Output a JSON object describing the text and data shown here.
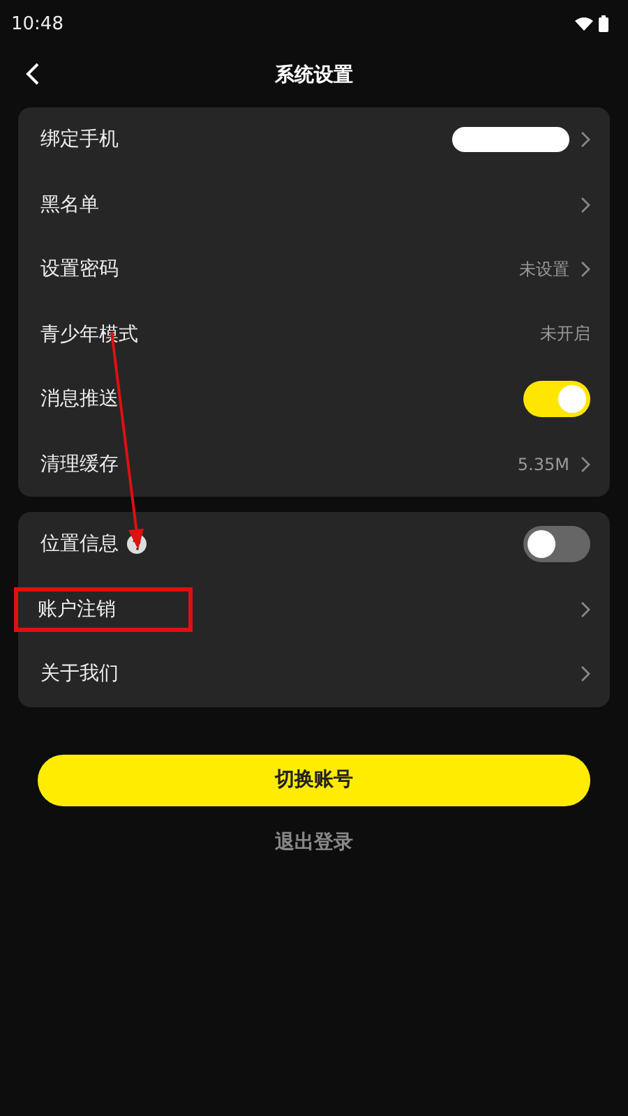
{
  "status_bar": {
    "time": "10:48"
  },
  "header": {
    "title": "系统设置"
  },
  "groups": [
    {
      "rows": [
        {
          "kind": "masked",
          "label": "绑定手机",
          "chevron": true
        },
        {
          "kind": "link",
          "label": "黑名单",
          "chevron": true
        },
        {
          "kind": "value",
          "label": "设置密码",
          "value": "未设置",
          "chevron": true
        },
        {
          "kind": "value",
          "label": "青少年模式",
          "value": "未开启",
          "chevron": false
        },
        {
          "kind": "toggle",
          "label": "消息推送",
          "on": true
        },
        {
          "kind": "value",
          "label": "清理缓存",
          "value": "5.35M",
          "chevron": true
        }
      ]
    },
    {
      "rows": [
        {
          "kind": "toggle",
          "label": "位置信息",
          "on": false,
          "help": true
        },
        {
          "kind": "link",
          "label": "账户注销",
          "chevron": true,
          "highlighted": true
        },
        {
          "kind": "link",
          "label": "关于我们",
          "chevron": true
        }
      ]
    }
  ],
  "primary_button": "切换账号",
  "logout": "退出登录"
}
